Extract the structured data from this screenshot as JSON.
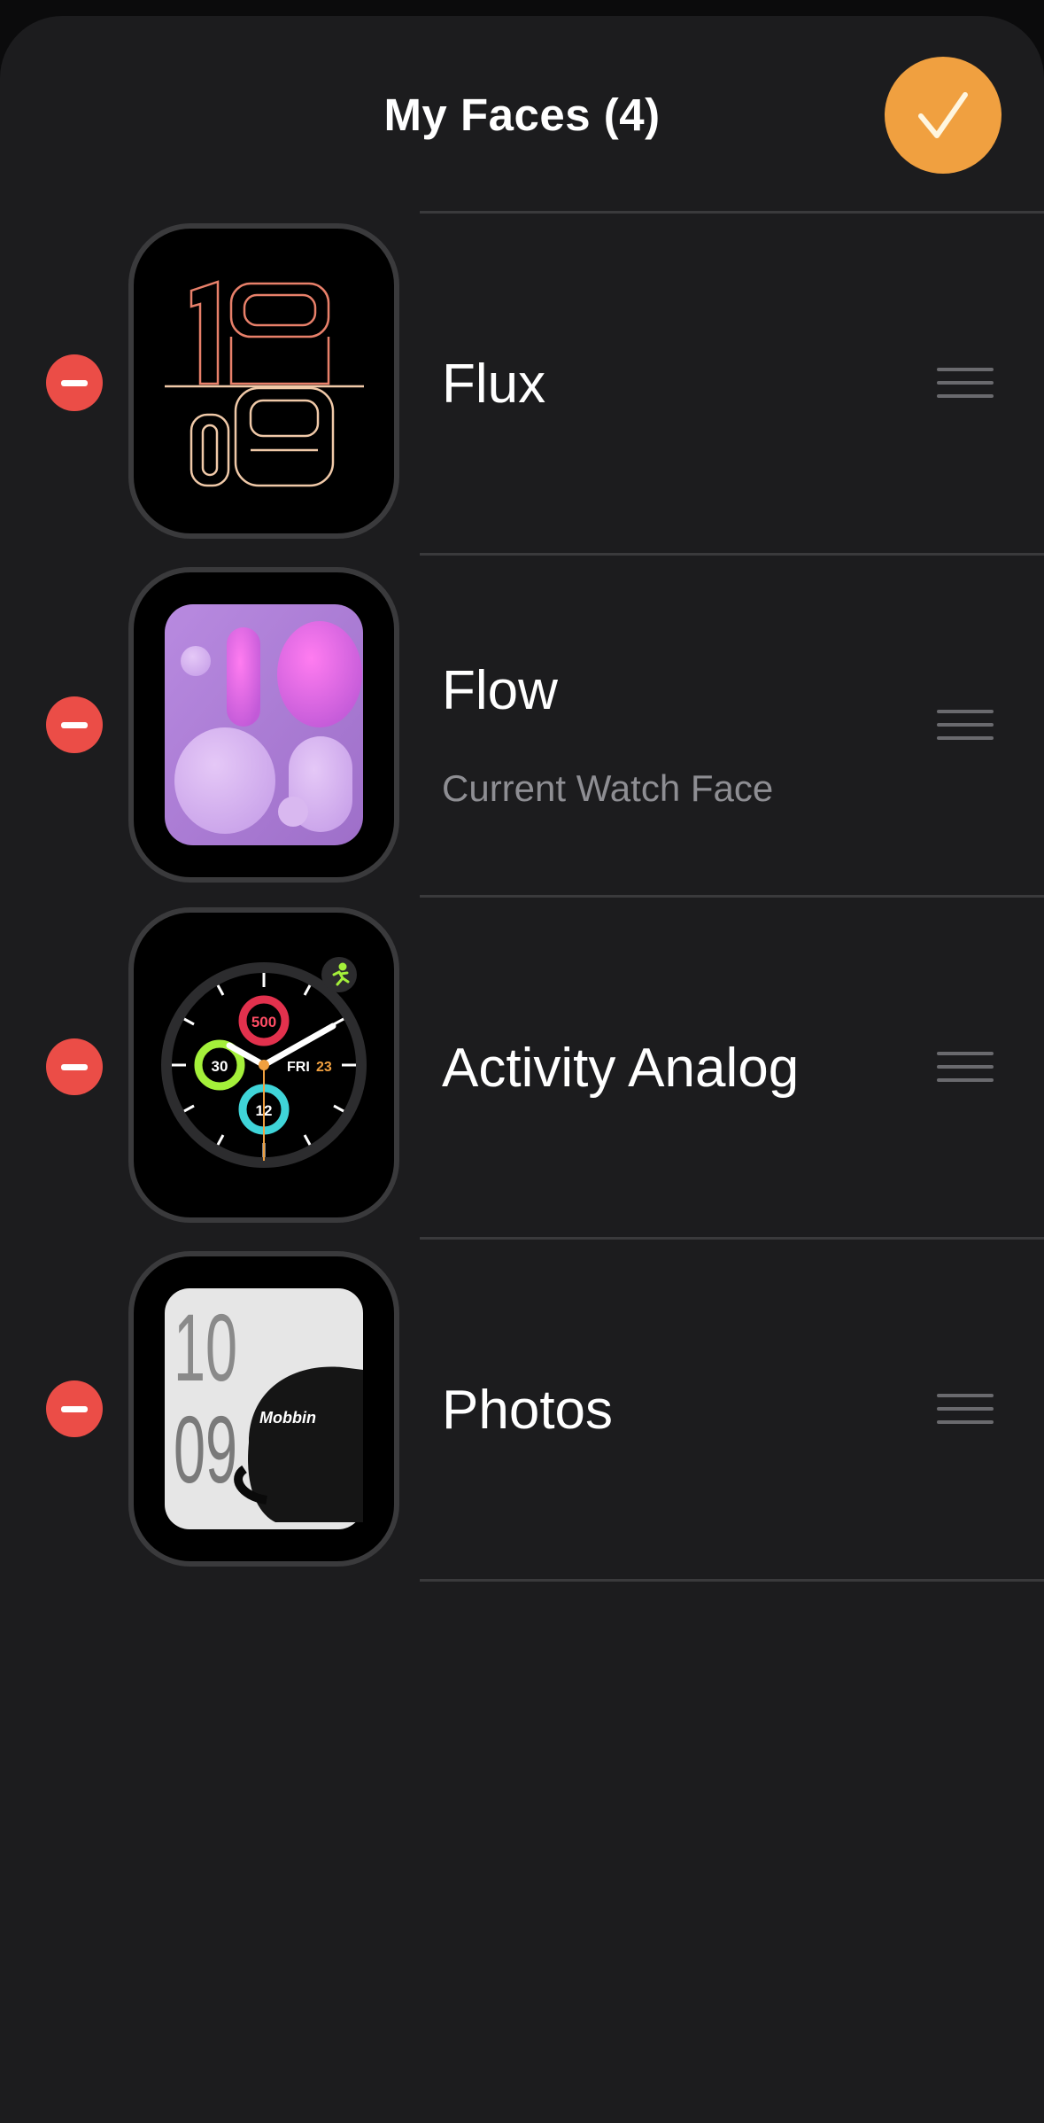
{
  "header": {
    "title": "My Faces (4)",
    "done_icon": "checkmark-icon",
    "accent": "#f0a040"
  },
  "faces": [
    {
      "name": "Flux",
      "subtitle": "",
      "thumb_time": [
        "10",
        "09"
      ]
    },
    {
      "name": "Flow",
      "subtitle": "Current Watch Face"
    },
    {
      "name": "Activity Analog",
      "subtitle": "",
      "complications": {
        "move": "500",
        "exercise": "30",
        "stand": "12",
        "date_day": "FRI",
        "date_num": "23"
      }
    },
    {
      "name": "Photos",
      "subtitle": "",
      "photo_time_top": "10",
      "photo_time_bottom": "09",
      "cap_text": "Mobbin"
    }
  ],
  "colors": {
    "delete": "#eb4d47",
    "background": "#1c1c1e",
    "separator": "#3a3a3c",
    "secondary_text": "#8e8e93"
  }
}
